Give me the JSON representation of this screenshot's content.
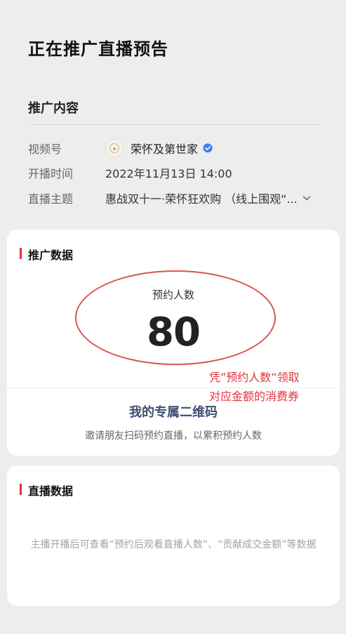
{
  "page_title": "正在推广直播预告",
  "promo_content": {
    "heading": "推广内容",
    "rows": {
      "channel": {
        "label": "视频号",
        "value": "荣怀及第世家",
        "verified": true,
        "avatar_icon": "channel-logo"
      },
      "start_time": {
        "label": "开播时间",
        "value": "2022年11月13日 14:00"
      },
      "topic": {
        "label": "直播主题",
        "value": "惠战双十一·荣怀狂欢购 （线上围观“...",
        "expand_icon": "chevron-down-icon"
      }
    }
  },
  "promo_data": {
    "heading": "推广数据",
    "reservation_label": "预约人数",
    "reservation_count": "80",
    "annotation_line1": "凭”预约人数”领取",
    "annotation_line2": "对应金额的消费券",
    "qr_link": "我的专属二维码",
    "qr_hint": "邀请朋友扫码预约直播，以累积预约人数"
  },
  "live_data": {
    "heading": "直播数据",
    "empty_text": "主播开播后可查看“预约后观看直播人数”、“贡献成交金额”等数据"
  },
  "colors": {
    "accent_red": "#e2323d",
    "link_blue": "#3e4e73",
    "verified_blue": "#3b7cf5"
  }
}
